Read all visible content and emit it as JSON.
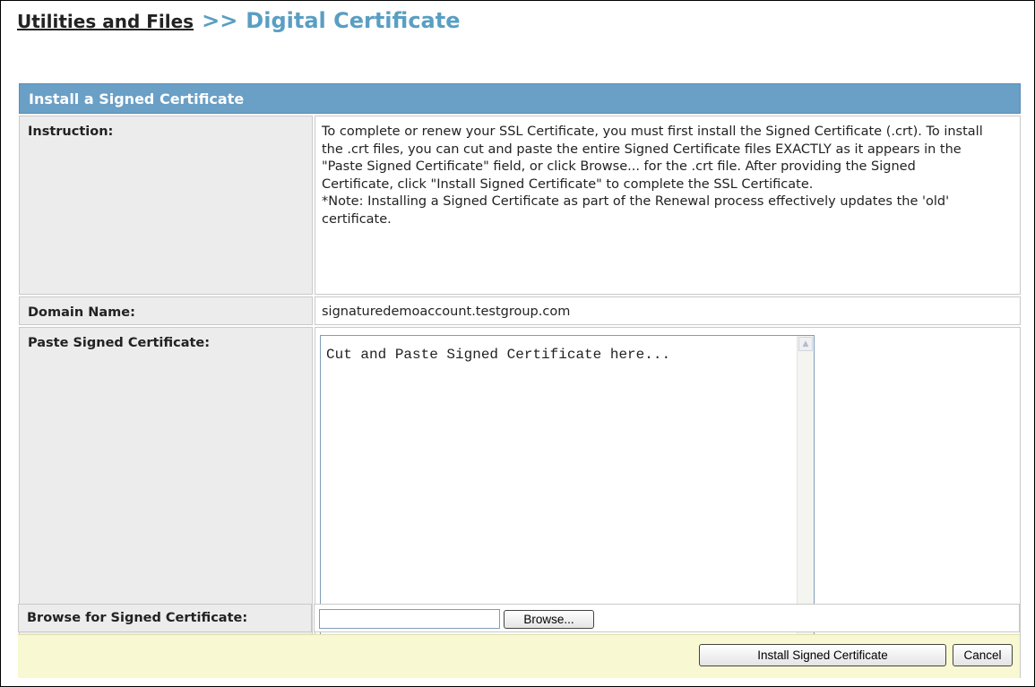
{
  "breadcrumb": {
    "parent": "Utilities and Files",
    "separator": ">>",
    "current": "Digital Certificate"
  },
  "panel": {
    "title": "Install a Signed Certificate",
    "rows": {
      "instruction": {
        "label": "Instruction:",
        "text": "To complete or renew your SSL Certificate, you must first install the Signed Certificate (.crt). To install the .crt files, you can cut and paste the entire Signed Certificate files EXACTLY as it appears in the \"Paste Signed Certificate\" field, or click Browse... for the .crt file. After providing the Signed Certificate, click \"Install Signed Certificate\" to complete the SSL Certificate.",
        "note": "*Note: Installing a Signed Certificate as part of the Renewal process effectively updates the 'old' certificate."
      },
      "domain": {
        "label": "Domain Name:",
        "value": "signaturedemoaccount.testgroup.com"
      },
      "paste": {
        "label": "Paste Signed Certificate:",
        "placeholder": "Cut and Paste Signed Certificate here..."
      },
      "browse": {
        "label": "Browse for Signed Certificate:",
        "value": "",
        "button": "Browse..."
      }
    }
  },
  "footer": {
    "install_button": "Install Signed Certificate",
    "cancel_button": "Cancel"
  },
  "icons": {
    "scroll_up": "scroll-up-arrow-icon",
    "scroll_down": "scroll-down-arrow-icon",
    "scroll_left": "scroll-left-arrow-icon",
    "scroll_right": "scroll-right-arrow-icon"
  }
}
